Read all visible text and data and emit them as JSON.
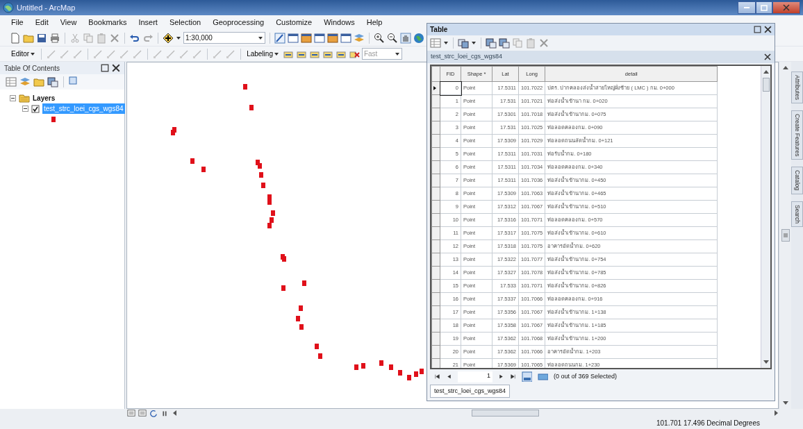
{
  "window": {
    "title": "Untitled - ArcMap"
  },
  "menu": [
    "File",
    "Edit",
    "View",
    "Bookmarks",
    "Insert",
    "Selection",
    "Geoprocessing",
    "Customize",
    "Windows",
    "Help"
  ],
  "toolbar": {
    "scale": "1:30,000",
    "editor": "Editor",
    "labeling": "Labeling",
    "label_quality": "Fast"
  },
  "toc": {
    "title": "Table Of Contents",
    "root": {
      "label": "Layers",
      "expanded": true,
      "children": [
        {
          "label": "test_strc_loei_cgs_wgs84",
          "checked": true,
          "selected": true,
          "expanded": true
        }
      ]
    }
  },
  "table_window": {
    "title": "Table",
    "tab": "test_strc_loei_cgs_wgs84",
    "columns": [
      "FID",
      "Shape *",
      "Lat",
      "Long",
      "detail"
    ],
    "rows": [
      {
        "cells": [
          "0",
          "Point",
          "17.5311",
          "101.7022",
          "ปตร. ปากคลองส่งน้ำสายใหญ่ฝั่งซ้าย ( LMC ) กม. 0+000"
        ],
        "current": true
      },
      {
        "cells": [
          "1",
          "Point",
          "17.531",
          "101.7021",
          "ท่อส่งน้ำเข้านา กม. 0+020"
        ],
        "current": false
      },
      {
        "cells": [
          "2",
          "Point",
          "17.5301",
          "101.7018",
          "ท่อส่งน้ำเข้านากม. 0+075"
        ],
        "current": false
      },
      {
        "cells": [
          "3",
          "Point",
          "17.531",
          "101.7025",
          "ท่อลอดคลองกม. 0+090"
        ],
        "current": false
      },
      {
        "cells": [
          "4",
          "Point",
          "17.5309",
          "101.7029",
          "ท่อลอดถนนลัดน้ำกม. 0+121"
        ],
        "current": false
      },
      {
        "cells": [
          "5",
          "Point",
          "17.5311",
          "101.7031",
          "ท่อรับน้ำกม. 0+180"
        ],
        "current": false
      },
      {
        "cells": [
          "6",
          "Point",
          "17.5311",
          "101.7034",
          "ท่อลอดคลองกม. 0+340"
        ],
        "current": false
      },
      {
        "cells": [
          "7",
          "Point",
          "17.5311",
          "101.7036",
          "ท่อส่งน้ำเข้านากม. 0+450"
        ],
        "current": false
      },
      {
        "cells": [
          "8",
          "Point",
          "17.5309",
          "101.7063",
          "ท่อส่งน้ำเข้านากม. 0+465"
        ],
        "current": false
      },
      {
        "cells": [
          "9",
          "Point",
          "17.5312",
          "101.7067",
          "ท่อส่งน้ำเข้านากม. 0+510"
        ],
        "current": false
      },
      {
        "cells": [
          "10",
          "Point",
          "17.5316",
          "101.7071",
          "ท่อลอดคลองกม. 0+570"
        ],
        "current": false
      },
      {
        "cells": [
          "11",
          "Point",
          "17.5317",
          "101.7075",
          "ท่อส่งน้ำเข้านากม. 0+610"
        ],
        "current": false
      },
      {
        "cells": [
          "12",
          "Point",
          "17.5318",
          "101.7075",
          "อาคารอัดน้ำกม. 0+620"
        ],
        "current": false
      },
      {
        "cells": [
          "13",
          "Point",
          "17.5322",
          "101.7077",
          "ท่อส่งน้ำเข้านากม. 0+754"
        ],
        "current": false
      },
      {
        "cells": [
          "14",
          "Point",
          "17.5327",
          "101.7078",
          "ท่อส่งน้ำเข้านากม. 0+785"
        ],
        "current": false
      },
      {
        "cells": [
          "15",
          "Point",
          "17.533",
          "101.7071",
          "ท่อส่งน้ำเข้านากม. 0+826"
        ],
        "current": false
      },
      {
        "cells": [
          "16",
          "Point",
          "17.5337",
          "101.7066",
          "ท่อลอดคลองกม. 0+916"
        ],
        "current": false
      },
      {
        "cells": [
          "17",
          "Point",
          "17.5356",
          "101.7067",
          "ท่อส่งน้ำเข้านากม. 1+138"
        ],
        "current": false
      },
      {
        "cells": [
          "18",
          "Point",
          "17.5358",
          "101.7067",
          "ท่อส่งน้ำเข้านากม. 1+185"
        ],
        "current": false
      },
      {
        "cells": [
          "19",
          "Point",
          "17.5362",
          "101.7068",
          "ท่อส่งน้ำเข้านากม. 1+200"
        ],
        "current": false
      },
      {
        "cells": [
          "20",
          "Point",
          "17.5362",
          "101.7066",
          "อาคารอัดน้ำกม. 1+203"
        ],
        "current": false
      },
      {
        "cells": [
          "21",
          "Point",
          "17.5369",
          "101.7065",
          "ท่อลอดถนนกม. 1+230"
        ],
        "current": false
      }
    ],
    "record": "1",
    "selection": "(0 out of 369 Selected)",
    "bottom_tabs": [
      {
        "label": "test_strc_loei_cgs_wgs84",
        "selected": true
      }
    ]
  },
  "dock_tabs": [
    "Attributes",
    "Create Features",
    "Catalog",
    "Search"
  ],
  "status_bar": {
    "coordinates": "101.701  17.496 Decimal Degrees"
  }
}
